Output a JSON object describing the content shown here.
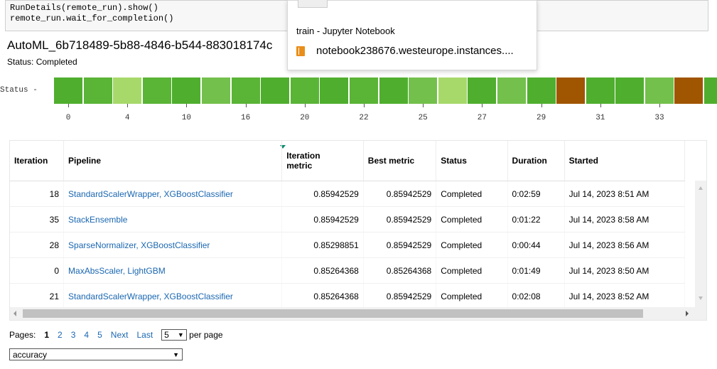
{
  "code": {
    "line1": "RunDetails(remote_run).show()",
    "line2": "remote_run.wait_for_completion()"
  },
  "run": {
    "title": "AutoML_6b718489-5b88-4846-b544-883018174c",
    "status": "Status: Completed"
  },
  "status_strip": {
    "label": "Status -",
    "colors": [
      "#4fae2e",
      "#5ab436",
      "#a6d96a",
      "#5ab436",
      "#4fae2e",
      "#73c04c",
      "#5ab436",
      "#4fae2e",
      "#5ab436",
      "#4fae2e",
      "#5ab436",
      "#4fae2e",
      "#73c04c",
      "#a6d96a",
      "#4fae2e",
      "#73c04c",
      "#4fae2e",
      "#a05500",
      "#4fae2e",
      "#4fae2e",
      "#73c04c",
      "#a05500",
      "#4fae2e"
    ],
    "ticks": [
      {
        "label": "0",
        "index": 0
      },
      {
        "label": "4",
        "index": 2
      },
      {
        "label": "10",
        "index": 4
      },
      {
        "label": "16",
        "index": 6
      },
      {
        "label": "20",
        "index": 8
      },
      {
        "label": "22",
        "index": 10
      },
      {
        "label": "25",
        "index": 12
      },
      {
        "label": "27",
        "index": 14
      },
      {
        "label": "29",
        "index": 16
      },
      {
        "label": "31",
        "index": 18
      },
      {
        "label": "33",
        "index": 20
      }
    ]
  },
  "popup": {
    "title": "train - Jupyter Notebook",
    "url": "notebook238676.westeurope.instances...."
  },
  "table": {
    "headers": {
      "iteration": "Iteration",
      "pipeline": "Pipeline",
      "iteration_metric_1": "Iteration",
      "iteration_metric_2": "metric",
      "best_metric": "Best metric",
      "status": "Status",
      "duration": "Duration",
      "started": "Started"
    },
    "rows": [
      {
        "iteration": "18",
        "pipeline": "StandardScalerWrapper, XGBoostClassifier",
        "metric": "0.85942529",
        "best": "0.85942529",
        "status": "Completed",
        "duration": "0:02:59",
        "started": "Jul 14, 2023 8:51 AM"
      },
      {
        "iteration": "35",
        "pipeline": "StackEnsemble",
        "metric": "0.85942529",
        "best": "0.85942529",
        "status": "Completed",
        "duration": "0:01:22",
        "started": "Jul 14, 2023 8:58 AM"
      },
      {
        "iteration": "28",
        "pipeline": "SparseNormalizer, XGBoostClassifier",
        "metric": "0.85298851",
        "best": "0.85942529",
        "status": "Completed",
        "duration": "0:00:44",
        "started": "Jul 14, 2023 8:56 AM"
      },
      {
        "iteration": "0",
        "pipeline": "MaxAbsScaler, LightGBM",
        "metric": "0.85264368",
        "best": "0.85264368",
        "status": "Completed",
        "duration": "0:01:49",
        "started": "Jul 14, 2023 8:50 AM"
      },
      {
        "iteration": "21",
        "pipeline": "StandardScalerWrapper, XGBoostClassifier",
        "metric": "0.85264368",
        "best": "0.85942529",
        "status": "Completed",
        "duration": "0:02:08",
        "started": "Jul 14, 2023 8:52 AM"
      }
    ]
  },
  "pager": {
    "label": "Pages:",
    "current": "1",
    "pages": [
      "2",
      "3",
      "4",
      "5"
    ],
    "next": "Next",
    "last": "Last",
    "per_page_value": "5",
    "per_page_label": "per page"
  },
  "metric_select": {
    "value": "accuracy"
  }
}
